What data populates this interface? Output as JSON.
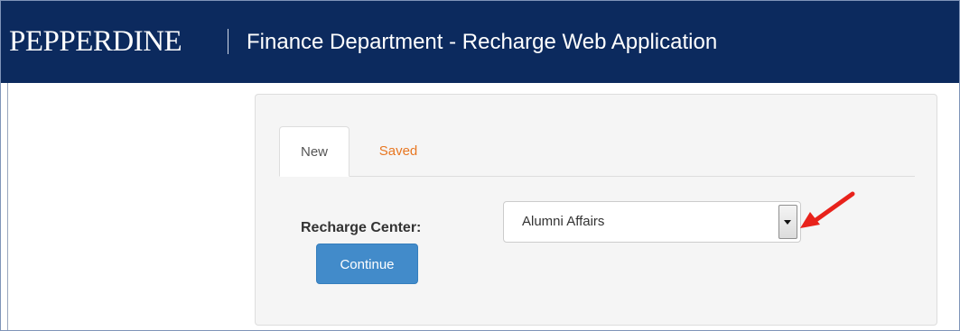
{
  "header": {
    "brand": "PEPPERDINE",
    "title": "Finance Department - Recharge Web Application",
    "background_color": "#0c2a5e"
  },
  "tabs": [
    {
      "label": "New",
      "active": true
    },
    {
      "label": "Saved",
      "active": false,
      "color": "#e87722"
    }
  ],
  "form": {
    "recharge_center_label": "Recharge Center:",
    "recharge_center_value": "Alumni Affairs",
    "continue_label": "Continue",
    "continue_color": "#428bca"
  },
  "annotation": {
    "arrow_color": "#e8221b",
    "arrow_icon": "red-arrow-icon"
  }
}
